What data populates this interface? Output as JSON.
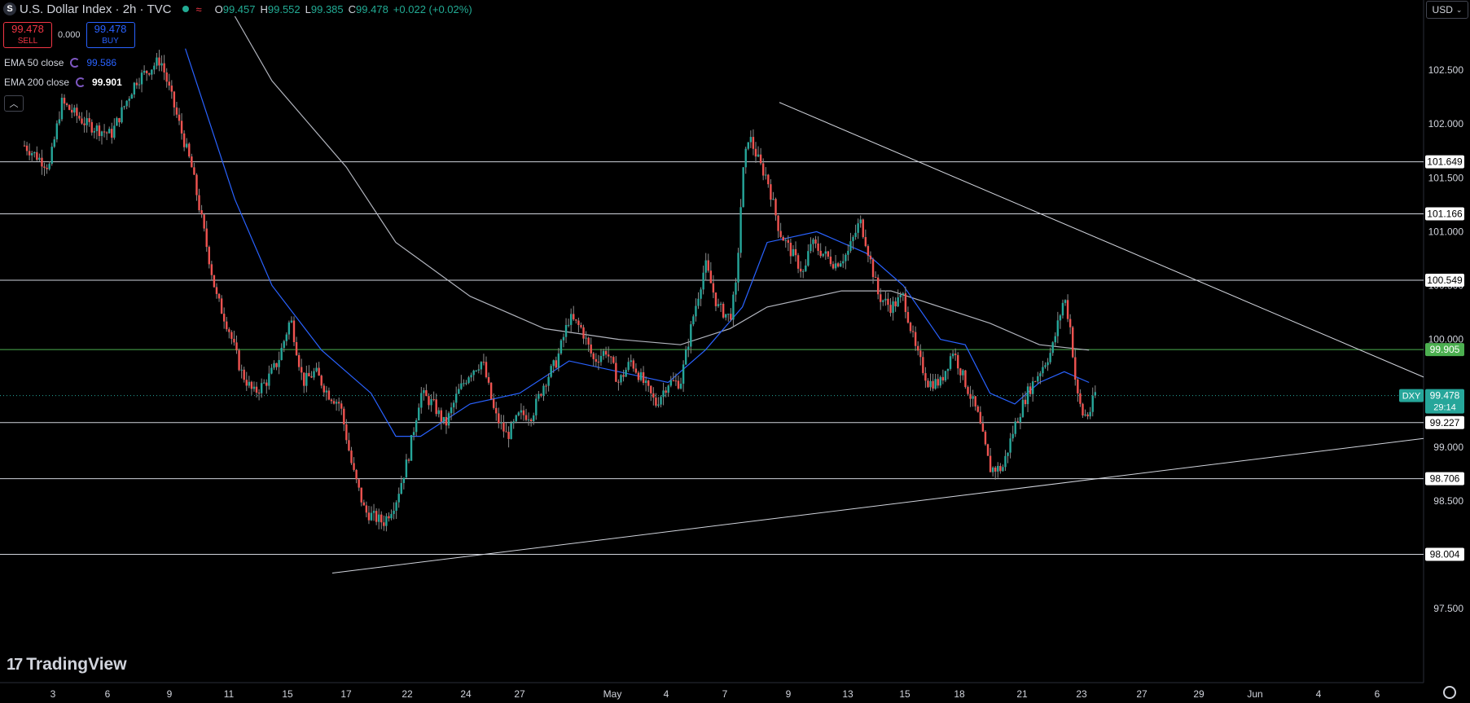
{
  "header": {
    "symbol_icon": "S",
    "title": "U.S. Dollar Index · 2h · TVC",
    "ohlc": [
      {
        "label": "O",
        "value": "99.457"
      },
      {
        "label": "H",
        "value": "99.552"
      },
      {
        "label": "L",
        "value": "99.385"
      },
      {
        "label": "C",
        "value": "99.478"
      }
    ],
    "change": "+0.022 (+0.02%)"
  },
  "trade": {
    "sell_price": "99.478",
    "sell_label": "SELL",
    "spread": "0.000",
    "buy_price": "99.478",
    "buy_label": "BUY"
  },
  "indicators": [
    {
      "label": "EMA 50 close",
      "value": "99.586",
      "color": "#2962ff"
    },
    {
      "label": "EMA 200 close",
      "value": "99.901",
      "color": "#d1d4dc"
    }
  ],
  "currency": "USD",
  "logo_text": "TradingView",
  "colors": {
    "up": "#26a69a",
    "down": "#ef5350",
    "ema50": "#2962ff",
    "ema200": "#b2b5be"
  },
  "chart_data": {
    "type": "candlestick",
    "timeframe": "2h",
    "ylim": [
      97.1,
      103.0
    ],
    "y_ticks": [
      97.5,
      98.0,
      98.5,
      99.0,
      99.5,
      100.0,
      100.5,
      101.0,
      101.5,
      102.0,
      102.5
    ],
    "x_ticks": [
      {
        "label": "3",
        "i": 0
      },
      {
        "label": "6",
        "i": 1
      },
      {
        "label": "9",
        "i": 2
      },
      {
        "label": "11",
        "i": 3
      },
      {
        "label": "15",
        "i": 4
      },
      {
        "label": "17",
        "i": 5
      },
      {
        "label": "22",
        "i": 6
      },
      {
        "label": "24",
        "i": 7
      },
      {
        "label": "27",
        "i": 8
      },
      {
        "label": "May",
        "i": 9
      },
      {
        "label": "4",
        "i": 10
      },
      {
        "label": "7",
        "i": 11
      },
      {
        "label": "9",
        "i": 12
      },
      {
        "label": "13",
        "i": 13
      },
      {
        "label": "15",
        "i": 14
      },
      {
        "label": "18",
        "i": 15
      },
      {
        "label": "21",
        "i": 16
      },
      {
        "label": "23",
        "i": 17
      },
      {
        "label": "27",
        "i": 18
      },
      {
        "label": "29",
        "i": 19
      },
      {
        "label": "Jun",
        "i": 20
      },
      {
        "label": "4",
        "i": 21
      },
      {
        "label": "6",
        "i": 22
      }
    ],
    "x_tick_positions": [
      65,
      132,
      208,
      281,
      353,
      425,
      500,
      572,
      638,
      752,
      818,
      890,
      968,
      1041,
      1111,
      1178,
      1255,
      1328,
      1402,
      1472,
      1541,
      1619,
      1691
    ],
    "horizontal_levels": [
      {
        "value": 101.649,
        "label": "101.649",
        "color": "#d1d4dc"
      },
      {
        "value": 101.166,
        "label": "101.166",
        "color": "#d1d4dc"
      },
      {
        "value": 100.549,
        "label": "100.549",
        "color": "#d1d4dc"
      },
      {
        "value": 99.905,
        "label": "99.905",
        "color": "#4caf50"
      },
      {
        "value": 99.227,
        "label": "99.227",
        "color": "#d1d4dc"
      },
      {
        "value": 98.706,
        "label": "98.706",
        "color": "#d1d4dc"
      },
      {
        "value": 98.004,
        "label": "98.004",
        "color": "#d1d4dc"
      }
    ],
    "last_price": {
      "symbol": "DXY",
      "value": "99.478",
      "countdown": "29:14",
      "price": 99.478
    },
    "trendlines": [
      {
        "from": {
          "t": "Apr 17",
          "y": 97.83
        },
        "to": {
          "t": "Jun 8",
          "y": 99.08
        }
      },
      {
        "from": {
          "t": "May 10",
          "y": 102.2
        },
        "to": {
          "t": "Jun 8",
          "y": 99.65
        }
      }
    ],
    "price_path": [
      [
        0,
        101.8
      ],
      [
        0.02,
        101.6
      ],
      [
        0.03,
        102.2
      ],
      [
        0.05,
        102.0
      ],
      [
        0.07,
        101.9
      ],
      [
        0.09,
        102.4
      ],
      [
        0.11,
        102.6
      ],
      [
        0.125,
        102.0
      ],
      [
        0.135,
        101.6
      ],
      [
        0.145,
        101.0
      ],
      [
        0.155,
        100.4
      ],
      [
        0.165,
        100.1
      ],
      [
        0.175,
        99.7
      ],
      [
        0.185,
        99.5
      ],
      [
        0.195,
        99.6
      ],
      [
        0.205,
        99.8
      ],
      [
        0.215,
        100.2
      ],
      [
        0.225,
        99.6
      ],
      [
        0.235,
        99.7
      ],
      [
        0.245,
        99.5
      ],
      [
        0.255,
        99.4
      ],
      [
        0.265,
        98.8
      ],
      [
        0.275,
        98.4
      ],
      [
        0.29,
        98.3
      ],
      [
        0.3,
        98.5
      ],
      [
        0.31,
        98.9
      ],
      [
        0.32,
        99.5
      ],
      [
        0.33,
        99.4
      ],
      [
        0.34,
        99.2
      ],
      [
        0.35,
        99.5
      ],
      [
        0.36,
        99.7
      ],
      [
        0.37,
        99.8
      ],
      [
        0.38,
        99.3
      ],
      [
        0.39,
        99.1
      ],
      [
        0.4,
        99.3
      ],
      [
        0.41,
        99.3
      ],
      [
        0.42,
        99.6
      ],
      [
        0.43,
        99.8
      ],
      [
        0.44,
        100.2
      ],
      [
        0.45,
        100.1
      ],
      [
        0.46,
        99.8
      ],
      [
        0.47,
        99.9
      ],
      [
        0.48,
        99.6
      ],
      [
        0.49,
        99.8
      ],
      [
        0.5,
        99.6
      ],
      [
        0.51,
        99.4
      ],
      [
        0.52,
        99.6
      ],
      [
        0.53,
        99.6
      ],
      [
        0.54,
        100.2
      ],
      [
        0.55,
        100.7
      ],
      [
        0.56,
        100.3
      ],
      [
        0.57,
        100.2
      ],
      [
        0.575,
        100.5
      ],
      [
        0.58,
        101.5
      ],
      [
        0.585,
        101.9
      ],
      [
        0.595,
        101.6
      ],
      [
        0.6,
        101.5
      ],
      [
        0.61,
        101.0
      ],
      [
        0.62,
        100.8
      ],
      [
        0.63,
        100.6
      ],
      [
        0.635,
        100.9
      ],
      [
        0.645,
        100.8
      ],
      [
        0.655,
        100.7
      ],
      [
        0.665,
        100.8
      ],
      [
        0.675,
        101.1
      ],
      [
        0.68,
        100.9
      ],
      [
        0.69,
        100.4
      ],
      [
        0.7,
        100.3
      ],
      [
        0.71,
        100.4
      ],
      [
        0.72,
        99.9
      ],
      [
        0.73,
        99.6
      ],
      [
        0.74,
        99.6
      ],
      [
        0.75,
        99.9
      ],
      [
        0.76,
        99.6
      ],
      [
        0.77,
        99.3
      ],
      [
        0.78,
        98.8
      ],
      [
        0.79,
        98.8
      ],
      [
        0.8,
        99.2
      ],
      [
        0.81,
        99.5
      ],
      [
        0.82,
        99.7
      ],
      [
        0.83,
        99.9
      ],
      [
        0.84,
        100.4
      ],
      [
        0.845,
        100.1
      ],
      [
        0.85,
        99.5
      ],
      [
        0.855,
        99.3
      ],
      [
        0.86,
        99.3
      ],
      [
        0.865,
        99.5
      ]
    ],
    "ema50_path": [
      [
        0.13,
        102.7
      ],
      [
        0.17,
        101.3
      ],
      [
        0.2,
        100.5
      ],
      [
        0.24,
        99.9
      ],
      [
        0.28,
        99.5
      ],
      [
        0.3,
        99.1
      ],
      [
        0.32,
        99.1
      ],
      [
        0.36,
        99.4
      ],
      [
        0.4,
        99.5
      ],
      [
        0.44,
        99.8
      ],
      [
        0.48,
        99.7
      ],
      [
        0.52,
        99.6
      ],
      [
        0.55,
        99.9
      ],
      [
        0.58,
        100.3
      ],
      [
        0.6,
        100.9
      ],
      [
        0.64,
        101.0
      ],
      [
        0.68,
        100.8
      ],
      [
        0.71,
        100.5
      ],
      [
        0.74,
        100.0
      ],
      [
        0.76,
        99.95
      ],
      [
        0.78,
        99.5
      ],
      [
        0.8,
        99.4
      ],
      [
        0.82,
        99.6
      ],
      [
        0.84,
        99.7
      ],
      [
        0.86,
        99.6
      ]
    ],
    "ema200_path": [
      [
        0.17,
        103.0
      ],
      [
        0.2,
        102.4
      ],
      [
        0.26,
        101.6
      ],
      [
        0.3,
        100.9
      ],
      [
        0.36,
        100.4
      ],
      [
        0.42,
        100.1
      ],
      [
        0.48,
        100.0
      ],
      [
        0.53,
        99.95
      ],
      [
        0.57,
        100.1
      ],
      [
        0.6,
        100.3
      ],
      [
        0.66,
        100.45
      ],
      [
        0.7,
        100.45
      ],
      [
        0.74,
        100.3
      ],
      [
        0.78,
        100.15
      ],
      [
        0.82,
        99.95
      ],
      [
        0.86,
        99.9
      ]
    ]
  }
}
